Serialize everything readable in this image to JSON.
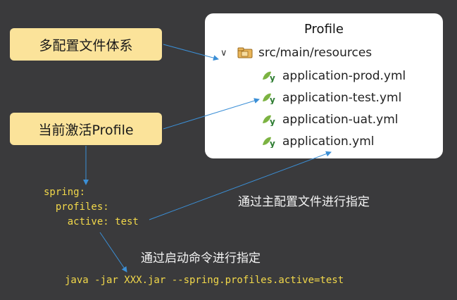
{
  "labels": {
    "multi_config": "多配置文件体系",
    "active_profile": "当前激活Profile"
  },
  "panel": {
    "title": "Profile",
    "root_folder": "src/main/resources",
    "root_icon": "package-folder-icon",
    "file_icon": "spring-leaf-icon",
    "files": [
      "application-prod.yml",
      "application-test.yml",
      "application-uat.yml",
      "application.yml"
    ]
  },
  "yaml": {
    "line1": "spring:",
    "line2": "  profiles:",
    "line3": "    active: test"
  },
  "notes": {
    "via_main_config": "通过主配置文件进行指定",
    "via_command": "通过启动命令进行指定"
  },
  "command": "java -jar XXX.jar --spring.profiles.active=test",
  "colors": {
    "background": "#3a3a3c",
    "label_bg": "#fbe39a",
    "code_text": "#f2d84a",
    "arrow": "#3b8fd6"
  }
}
